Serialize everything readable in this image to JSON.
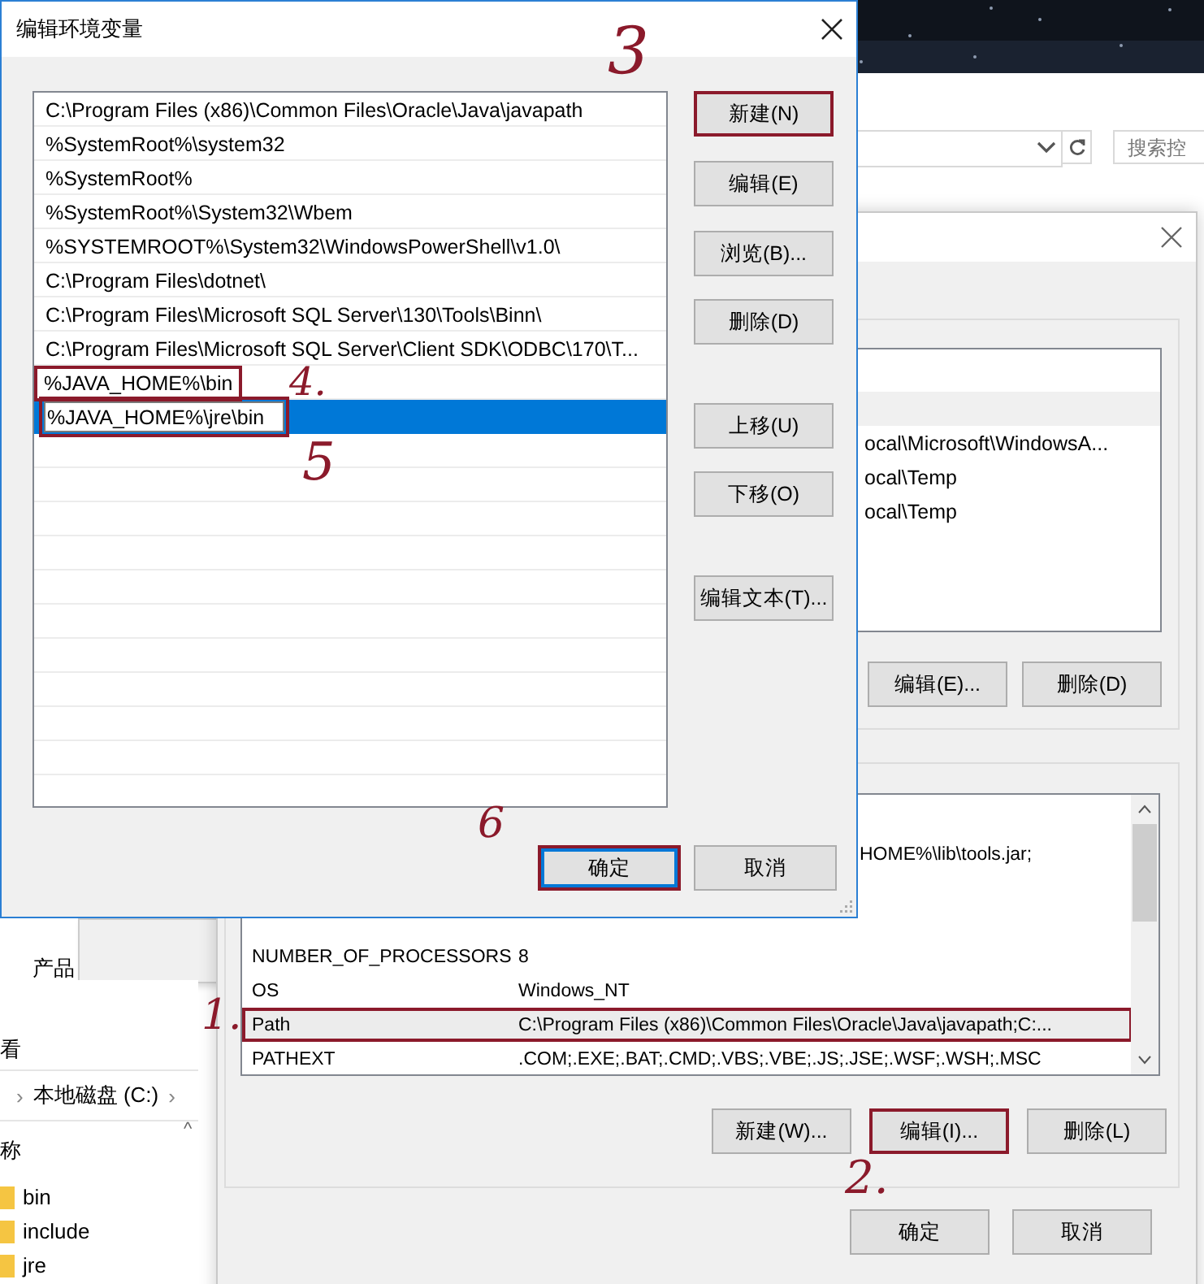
{
  "explorer": {
    "search": {
      "placeholder": "搜索控"
    },
    "popup": {
      "items": [
        "产品"
      ]
    },
    "view_label": "看",
    "breadcrumb": [
      "›",
      "本地磁盘 (C:)",
      "›"
    ],
    "column": "称",
    "sort_caret": "^",
    "files": [
      "bin",
      "include",
      "jre"
    ]
  },
  "env_window": {
    "user_vars": [
      {
        "selected": false
      },
      {
        "selected": true
      },
      {
        "value": "ocal\\Microsoft\\WindowsA...",
        "selected": false
      },
      {
        "value": "ocal\\Temp",
        "selected": false
      },
      {
        "value": "ocal\\Temp",
        "selected": false
      }
    ],
    "user_buttons": [
      {
        "label": "编辑(E)...",
        "annotated": false
      },
      {
        "label": "删除(D)",
        "annotated": false
      }
    ],
    "system_vars": [
      {
        "value": "HOME%\\lib\\tools.jar;",
        "selected": false
      },
      {
        "selected": false
      },
      {
        "selected": false
      },
      {
        "name": "NUMBER_OF_PROCESSORS",
        "value": "8",
        "selected": false
      },
      {
        "name": "OS",
        "value": "Windows_NT",
        "selected": false
      },
      {
        "name": "Path",
        "value": "C:\\Program Files (x86)\\Common Files\\Oracle\\Java\\javapath;C:...",
        "selected": true,
        "annotated": true
      },
      {
        "name": "PATHEXT",
        "value": ".COM;.EXE;.BAT;.CMD;.VBS;.VBE;.JS;.JSE;.WSF;.WSH;.MSC",
        "selected": false,
        "annotated": false
      }
    ],
    "system_buttons": [
      {
        "label": "新建(W)...",
        "annotated": false
      },
      {
        "label": "编辑(I)...",
        "annotated": true
      },
      {
        "label": "删除(L)",
        "annotated": false
      }
    ],
    "buttons": [
      {
        "label": "确定"
      },
      {
        "label": "取消"
      }
    ]
  },
  "dialog": {
    "title": "编辑环境变量",
    "entries": [
      {
        "text": "C:\\Program Files (x86)\\Common Files\\Oracle\\Java\\javapath",
        "selected": false,
        "editing": false,
        "annotated": false
      },
      {
        "text": "%SystemRoot%\\system32",
        "selected": false,
        "editing": false,
        "annotated": false
      },
      {
        "text": "%SystemRoot%",
        "selected": false,
        "editing": false,
        "annotated": false
      },
      {
        "text": "%SystemRoot%\\System32\\Wbem",
        "selected": false,
        "editing": false,
        "annotated": false
      },
      {
        "text": "%SYSTEMROOT%\\System32\\WindowsPowerShell\\v1.0\\",
        "selected": false,
        "editing": false,
        "annotated": false
      },
      {
        "text": "C:\\Program Files\\dotnet\\",
        "selected": false,
        "editing": false,
        "annotated": false
      },
      {
        "text": "C:\\Program Files\\Microsoft SQL Server\\130\\Tools\\Binn\\",
        "selected": false,
        "editing": false,
        "annotated": false
      },
      {
        "text": "C:\\Program Files\\Microsoft SQL Server\\Client SDK\\ODBC\\170\\T...",
        "selected": false,
        "editing": false,
        "annotated": false
      },
      {
        "text": "%JAVA_HOME%\\bin",
        "selected": false,
        "editing": false,
        "annotated": true
      },
      {
        "text": "%JAVA_HOME%\\jre\\bin",
        "selected": true,
        "editing": true,
        "annotated": true
      }
    ],
    "side_buttons": [
      {
        "label": "新建(N)",
        "annotated": true
      },
      {
        "label": "编辑(E)",
        "annotated": false
      },
      {
        "label": "浏览(B)...",
        "annotated": false
      },
      {
        "label": "删除(D)",
        "annotated": false
      },
      {
        "label": "上移(U)",
        "annotated": false
      },
      {
        "label": "下移(O)",
        "annotated": false
      },
      {
        "label": "编辑文本(T)...",
        "annotated": false
      }
    ],
    "buttons": [
      {
        "label": "确定",
        "annotated": true,
        "default": true
      },
      {
        "label": "取消",
        "annotated": false,
        "default": false
      }
    ]
  },
  "annotations": [
    {
      "text": "3"
    },
    {
      "text": "4."
    },
    {
      "text": "5"
    },
    {
      "text": "6"
    },
    {
      "text": "1."
    },
    {
      "text": "2."
    }
  ]
}
